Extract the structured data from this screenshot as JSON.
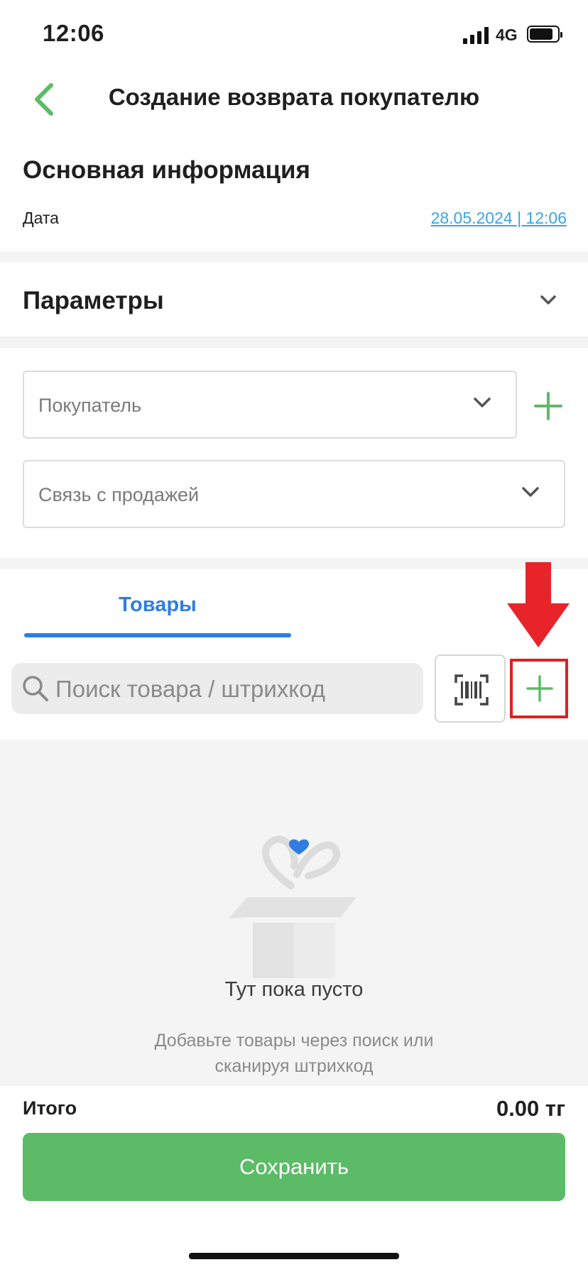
{
  "status_bar": {
    "time": "12:06",
    "network": "4G"
  },
  "header": {
    "title": "Создание возврата покупателю"
  },
  "main_info": {
    "title": "Основная информация",
    "date_label": "Дата",
    "date_value": "28.05.2024 | 12:06"
  },
  "parameters": {
    "title": "Параметры"
  },
  "fields": {
    "buyer_placeholder": "Покупатель",
    "sale_link_placeholder": "Связь с продажей"
  },
  "tabs": [
    {
      "label": "Товары",
      "active": true
    }
  ],
  "search": {
    "placeholder": "Поиск товара / штрихкод"
  },
  "empty_state": {
    "title": "Тут пока пусто",
    "subtitle_line1": "Добавьте товары через поиск или",
    "subtitle_line2": "сканируя штрихкод"
  },
  "footer": {
    "total_label": "Итого",
    "total_value": "0.00 тг",
    "save_label": "Сохранить"
  },
  "colors": {
    "accent_green": "#5cbb67",
    "accent_blue": "#2f7de1",
    "link_blue": "#3aa4ea",
    "highlight_red": "#e02020"
  },
  "icons": [
    "back-arrow-icon",
    "chevron-down-icon",
    "plus-icon",
    "search-icon",
    "barcode-scan-icon",
    "empty-box-icon",
    "red-arrow-annotation"
  ]
}
